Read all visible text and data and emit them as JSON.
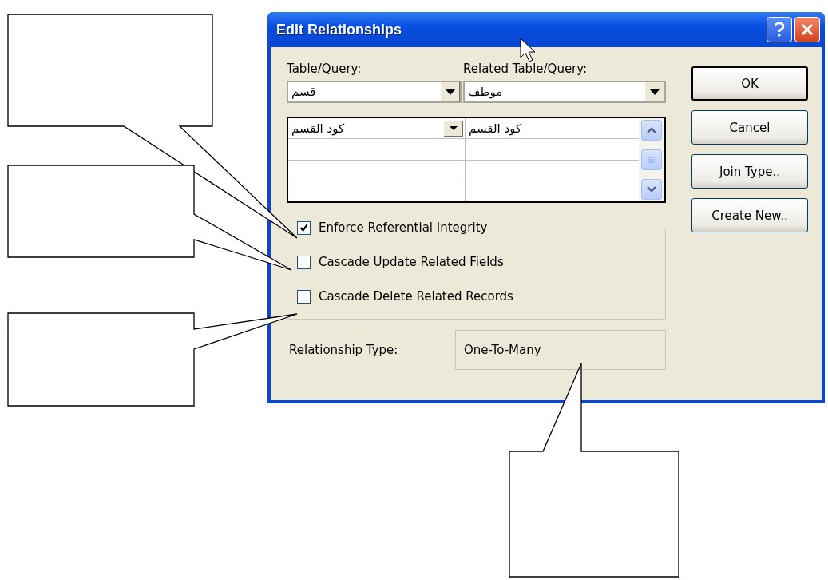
{
  "window": {
    "title": "Edit Relationships"
  },
  "labels": {
    "table": "Table/Query:",
    "related": "Related Table/Query:"
  },
  "combos": {
    "table": "قسم",
    "related": "موظف"
  },
  "fields": [
    {
      "table": "كود القسم",
      "related": "كود القسم"
    }
  ],
  "checks": [
    {
      "label": "Enforce Referential Integrity",
      "checked": true
    },
    {
      "label": "Cascade Update Related Fields",
      "checked": false
    },
    {
      "label": "Cascade Delete Related Records",
      "checked": false
    }
  ],
  "relationship": {
    "label": "Relationship Type:",
    "value": "One-To-Many"
  },
  "buttons": [
    "OK",
    "Cancel",
    "Join Type..",
    "Create New.."
  ]
}
